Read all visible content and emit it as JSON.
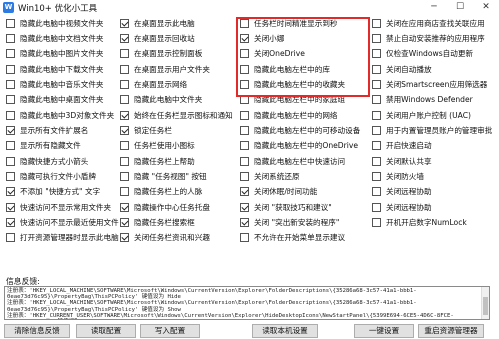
{
  "window": {
    "title": "Win10+ 优化小工具",
    "minimize": "─",
    "maximize": "☐",
    "close": "✕"
  },
  "columns": [
    [
      {
        "label": "隐藏此电脑中视频文件夹",
        "checked": false
      },
      {
        "label": "隐藏此电脑中文档文件夹",
        "checked": false
      },
      {
        "label": "隐藏此电脑中图片文件夹",
        "checked": false
      },
      {
        "label": "隐藏此电脑中下载文件夹",
        "checked": false
      },
      {
        "label": "隐藏此电脑中音乐文件夹",
        "checked": false
      },
      {
        "label": "隐藏此电脑中桌面文件夹",
        "checked": false
      },
      {
        "label": "隐藏此电脑中3D对象文件夹",
        "checked": false
      },
      {
        "label": "显示所有文件扩展名",
        "checked": true
      },
      {
        "label": "显示所有隐藏文件",
        "checked": false
      },
      {
        "label": "隐藏快捷方式小箭头",
        "checked": false
      },
      {
        "label": "隐藏可执行文件小盾牌",
        "checked": false
      },
      {
        "label": "不添加 \"快捷方式\" 文字",
        "checked": true
      },
      {
        "label": "快速访问不显示常用文件夹",
        "checked": true
      },
      {
        "label": "快速访问不显示最近使用文件",
        "checked": true
      },
      {
        "label": "打开资源管理器时显示此电脑",
        "checked": false
      }
    ],
    [
      {
        "label": "在桌面显示此电脑",
        "checked": true
      },
      {
        "label": "在桌面显示回收站",
        "checked": true
      },
      {
        "label": "在桌面显示控制面板",
        "checked": false
      },
      {
        "label": "在桌面显示用户文件夹",
        "checked": false
      },
      {
        "label": "在桌面显示网络",
        "checked": false
      },
      {
        "label": "隐藏此电脑中文件夹",
        "checked": false
      },
      {
        "label": "始终在任务栏显示图标和通知",
        "checked": true
      },
      {
        "label": "锁定任务栏",
        "checked": true
      },
      {
        "label": "任务栏使用小图标",
        "checked": false
      },
      {
        "label": "隐藏任务栏上帮助",
        "checked": false
      },
      {
        "label": "隐藏 \"任务视图\" 按钮",
        "checked": false
      },
      {
        "label": "隐藏任务栏上的人脉",
        "checked": false
      },
      {
        "label": "隐藏操作中心任务托盘",
        "checked": true
      },
      {
        "label": "隐藏任务栏搜索框",
        "checked": true
      },
      {
        "label": "关闭任务栏资讯和兴趣",
        "checked": true
      }
    ],
    [
      {
        "label": "任务栏时间精准显示到秒",
        "checked": false
      },
      {
        "label": "关闭小娜",
        "checked": true
      },
      {
        "label": "关闭OneDrive",
        "checked": false
      },
      {
        "label": "隐藏此电脑左栏中的库",
        "checked": false
      },
      {
        "label": "隐藏此电脑左栏中的收藏夹",
        "checked": false
      },
      {
        "label": "隐藏此电脑左栏中的家庭组",
        "checked": false
      },
      {
        "label": "隐藏此电脑左栏中的网络",
        "checked": false
      },
      {
        "label": "隐藏此电脑左栏中的可移动设备",
        "checked": false
      },
      {
        "label": "隐藏此电脑左栏中的OneDrive",
        "checked": false
      },
      {
        "label": "隐藏此电脑左栏中快速访问",
        "checked": false
      },
      {
        "label": "关闭系统还原",
        "checked": false
      },
      {
        "label": "关闭休眠/时间功能",
        "checked": true
      },
      {
        "label": "关闭 \"获取技巧和建议\"",
        "checked": true
      },
      {
        "label": "关闭 \"突出新安装的程序\"",
        "checked": true
      },
      {
        "label": "不允许在开始菜单显示建议",
        "checked": false
      }
    ],
    [
      {
        "label": "关闭在应用商店查找关联应用",
        "checked": false
      },
      {
        "label": "禁止自动安装推荐的应用程序",
        "checked": false
      },
      {
        "label": "仅检查Windows自动更新",
        "checked": false
      },
      {
        "label": "关闭自动播放",
        "checked": false
      },
      {
        "label": "关闭Smartscreen应用筛选器",
        "checked": false
      },
      {
        "label": "禁用Windows Defender",
        "checked": false
      },
      {
        "label": "关闭用户账户控制 (UAC)",
        "checked": false
      },
      {
        "label": "用于内置管理员账户的管理审批",
        "checked": false
      },
      {
        "label": "开启快速启动",
        "checked": false
      },
      {
        "label": "关闭默认共享",
        "checked": false
      },
      {
        "label": "关闭防火墙",
        "checked": false
      },
      {
        "label": "关闭远程协助",
        "checked": false
      },
      {
        "label": "关闭远程协助",
        "checked": false
      },
      {
        "label": "开机开启数字NumLock",
        "checked": false
      },
      {
        "label": "",
        "checked": false
      }
    ]
  ],
  "log": {
    "label": "信息反馈:",
    "lines": [
      "注册表：'HKEY_LOCAL_MACHINE\\SOFTWARE\\Microsoft\\Windows\\CurrentVersion\\Explorer\\FolderDescriptions\\{35286a68-3c57-41a1-bbb1-",
      "0eae73d76c95}\\PropertyBag\\ThisPCPolicy' 键值设为 Hide",
      "注册表：'HKEY_LOCAL_MACHINE\\SOFTWARE\\Microsoft\\Windows\\CurrentVersion\\Explorer\\FolderDescriptions\\{35286a68-3c57-41a1-bbb1-",
      "0eae73d76c95}\\PropertyBag\\ThisPCPolicy' 键值设为 Show",
      "注册表：'HKEY_CURRENT_USER\\SOFTWARE\\Microsoft\\Windows\\CurrentVersion\\Explorer\\HideDesktopIcons\\NewStartPanel\\{5399E694-6CE5-4D6C-8FCE-",
      "1D8870FDCBA0}' 键值设为 0"
    ]
  },
  "buttons": {
    "clear_log": "清除信息反馈",
    "read_config": "读取配置",
    "write_config": "写入配置",
    "read_local": "读取本机设置",
    "one_click": "一键设置",
    "restart_explorer": "重启资源管理器"
  },
  "watermark": {
    "main": "极光下载站",
    "sub": "www.xz7.com"
  }
}
